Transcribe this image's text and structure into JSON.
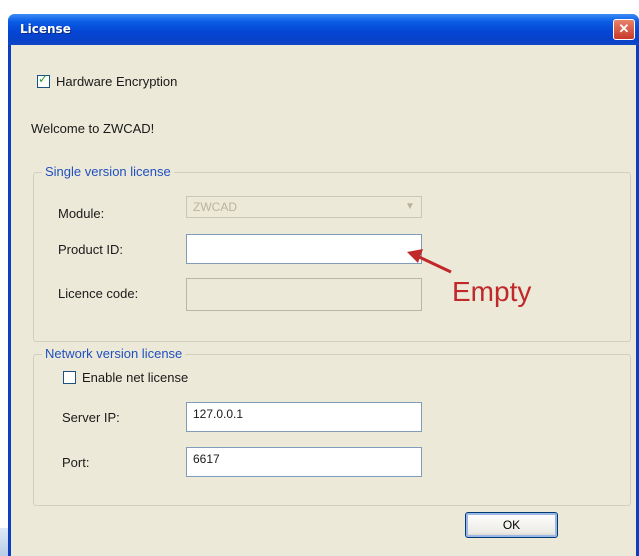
{
  "window": {
    "title": "License",
    "close_glyph": "✕"
  },
  "hardware_encryption": {
    "label": "Hardware Encryption",
    "checked": true
  },
  "welcome_text": "Welcome to ZWCAD!",
  "single_license": {
    "legend": "Single version license",
    "module_label": "Module:",
    "module_value": "ZWCAD",
    "product_id_label": "Product ID:",
    "product_id_value": "",
    "license_code_label": "Licence code:",
    "license_code_value": ""
  },
  "annotation": {
    "text": "Empty",
    "color": "#c0282a"
  },
  "network_license": {
    "legend": "Network version license",
    "enable_label": "Enable net license",
    "enable_checked": false,
    "server_ip_label": "Server IP:",
    "server_ip_value": "127.0.0.1",
    "port_label": "Port:",
    "port_value": "6617"
  },
  "ok_button": {
    "label": "OK"
  },
  "colors": {
    "titlebar": "#0546d6",
    "legend_text": "#2050c0",
    "window_bg": "#ece9d8"
  }
}
